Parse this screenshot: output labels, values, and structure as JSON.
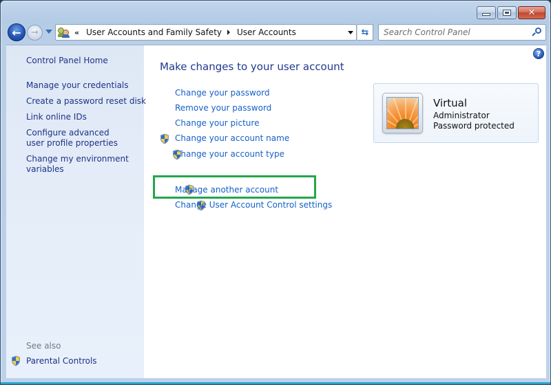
{
  "window": {
    "caption_buttons": {
      "minimize": "minimize-icon",
      "maximize": "maximize-icon",
      "close": "close-icon"
    }
  },
  "navigation": {
    "back_icon": "back-arrow-icon",
    "forward_icon": "forward-arrow-icon",
    "overflow": "«",
    "breadcrumbs": [
      {
        "label": "User Accounts and Family Safety"
      },
      {
        "label": "User Accounts"
      }
    ],
    "refresh_icon": "refresh-icon"
  },
  "search": {
    "placeholder": "Search Control Panel",
    "value": ""
  },
  "sidebar": {
    "home_link": "Control Panel Home",
    "links": [
      {
        "label": "Manage your credentials"
      },
      {
        "label": "Create a password reset disk"
      },
      {
        "label": "Link online IDs"
      },
      {
        "label": "Configure advanced user profile properties"
      },
      {
        "label": "Change my environment variables"
      }
    ],
    "see_also_label": "See also",
    "see_also_links": [
      {
        "label": "Parental Controls",
        "icon": "uac-shield-icon"
      }
    ]
  },
  "main": {
    "title": "Make changes to your user account",
    "tasks": [
      {
        "label": "Change your password",
        "shield": false
      },
      {
        "label": "Remove your password",
        "shield": false
      },
      {
        "label": "Change your picture",
        "shield": false
      },
      {
        "label": "Change your account name",
        "shield": true
      },
      {
        "label": "Change your account type",
        "shield": true
      }
    ],
    "other_tasks": [
      {
        "label": "Manage another account",
        "shield": true,
        "highlighted": true
      },
      {
        "label": "Change User Account Control settings",
        "shield": true
      }
    ],
    "highlight_color": "#22a64a",
    "help_icon": "?"
  },
  "account": {
    "name": "Virtual",
    "type": "Administrator",
    "status": "Password protected",
    "picture": "flower-picture"
  }
}
